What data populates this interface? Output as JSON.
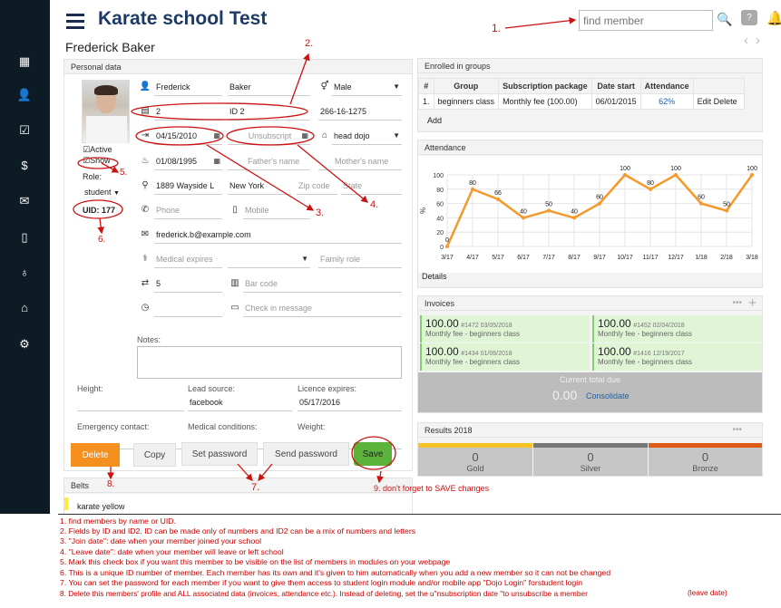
{
  "header": {
    "title": "Karate school Test",
    "search_placeholder": "find member"
  },
  "member_name": "Frederick Baker",
  "personal": {
    "panel_title": "Personal data",
    "first_name": "Frederick",
    "last_name": "Baker",
    "gender": "Male",
    "id": "2",
    "id2": "ID 2",
    "phone_ssn": "266-16-1275",
    "join_date": "04/15/2010",
    "unsubscribe_placeholder": "Unsubscript",
    "rank": "head dojo",
    "birth_date": "01/08/1995",
    "fathers_name_ph": "Father's name",
    "mothers_name_ph": "Mother's name",
    "address": "1889 Wayside L",
    "city": "New York",
    "zip_ph": "Zip code",
    "state_ph": "State",
    "phone_ph": "Phone",
    "mobile_ph": "Mobile",
    "email": "frederick.b@example.com",
    "medical_ph": "Medical expires",
    "family_role_ph": "Family role",
    "count": "5",
    "barcode_ph": "Bar code",
    "checkin_ph": "Check in message",
    "notes_label": "Notes:",
    "active_label": "Active",
    "show_label": "Show",
    "role_label": "Role:",
    "role_value": "student",
    "uid_label": "UID: 177",
    "height_label": "Height:",
    "lead_source_label": "Lead source:",
    "lead_source_value": "facebook",
    "licence_label": "Licence expires:",
    "licence_value": "05/17/2016",
    "emergency_label": "Emergency contact:",
    "medical_cond_label": "Medical conditions:",
    "weight_label": "Weight:"
  },
  "buttons": {
    "delete": "Delete",
    "copy": "Copy",
    "set_password": "Set password",
    "send_password": "Send password",
    "save": "Save"
  },
  "belts": {
    "title": "Belts",
    "item": "karate yellow"
  },
  "groups": {
    "title": "Enrolled in groups",
    "headers": [
      "#",
      "Group",
      "Subscription package",
      "Date start",
      "Attendance",
      ""
    ],
    "row": {
      "num": "1.",
      "group": "beginners class",
      "package": "Monthly fee (100.00)",
      "date": "06/01/2015",
      "attendance": "62%",
      "actions": "Edit Delete"
    },
    "add": "Add"
  },
  "attendance": {
    "title": "Attendance",
    "details": "Details",
    "y_label": "%"
  },
  "chart_data": {
    "type": "line",
    "x": [
      "3/17",
      "4/17",
      "5/17",
      "6/17",
      "7/17",
      "8/17",
      "9/17",
      "10/17",
      "11/17",
      "12/17",
      "1/18",
      "2/18",
      "3/18"
    ],
    "values": [
      0,
      80,
      66,
      40,
      50,
      40,
      60,
      100,
      80,
      100,
      60,
      50,
      100
    ],
    "data_labels": [
      "0",
      "80",
      "66",
      "40",
      "50",
      "40",
      "60",
      "100",
      "80",
      "100",
      "60",
      "50",
      "100"
    ],
    "y_ticks": [
      "0",
      "20",
      "40",
      "60",
      "80",
      "100"
    ],
    "ylim": [
      0,
      100
    ],
    "ylabel": "%",
    "grid": true,
    "color": "#f39a2b"
  },
  "invoices": {
    "title": "Invoices",
    "items": [
      {
        "amount": "100.00",
        "meta": "#1472 03/05/2018",
        "desc": "Monthly fee - beginners class"
      },
      {
        "amount": "100.00",
        "meta": "#1452 02/04/2018",
        "desc": "Monthly fee - beginners class"
      },
      {
        "amount": "100.00",
        "meta": "#1434 01/06/2018",
        "desc": "Monthly fee - beginners class"
      },
      {
        "amount": "100.00",
        "meta": "#1416 12/19/2017",
        "desc": "Monthly fee - beginners class"
      }
    ],
    "total_label": "Current total due",
    "total_amount": "0.00",
    "consolidate": "Consolidate"
  },
  "results": {
    "title": "Results 2018",
    "gold": "0",
    "gold_label": "Gold",
    "silver": "0",
    "silver_label": "Silver",
    "bronze": "0",
    "bronze_label": "Bronze",
    "colors": {
      "gold": "#f7c325",
      "silver": "#777777",
      "bronze": "#e05c16"
    }
  },
  "annotations": {
    "a1": "1.",
    "a2": "2.",
    "a3": "3.",
    "a4": "4.",
    "a5": "5.",
    "a6": "6.",
    "a7": "7.",
    "a8": "8.",
    "a9": "9. don't forget to SAVE changes"
  },
  "notes": [
    "1. find members by name or UID.",
    "2. Fields by ID and ID2. ID can be made only of numbers and ID2 can be a mix of numbers and letters",
    "3. \"Join date\": date when your member joined your school",
    "4. \"Leave date\": date when your member will leave or left school",
    "5. Mark this check box if you want this member to be visible on the list of members in modules on your webpage",
    "6. This is a unique ID number of member. Each member has its own and it's given to him automatically when you add a new member so it can not be changed",
    "7. You can set the password for each member if you want to give them access to student login module and/or mobile app \"Dojo Login\"  forstudent login",
    "8. Delete this members' profile  and ALL associated data (invoices, attendance etc.). Instead of deleting, set the u\"nsubscription date \"to unsubscribe a member",
    "(leave date)"
  ]
}
